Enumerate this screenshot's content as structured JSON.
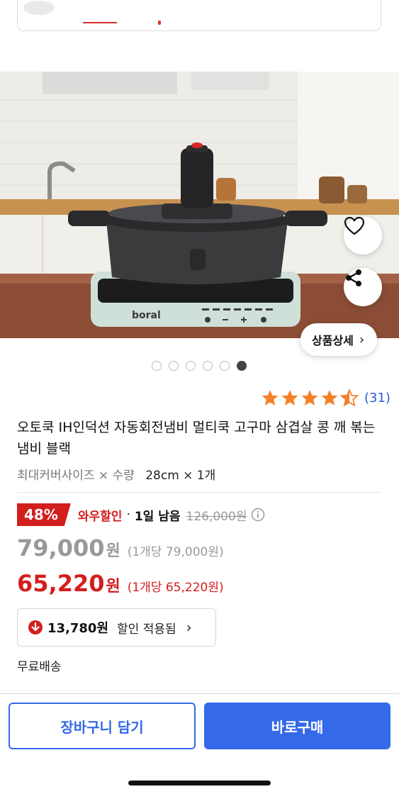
{
  "product": {
    "title": "오토쿡 IH인덕션 자동회전냄비 멀티쿡 고구마 삼겹살 콩 깨 볶는 냄비 블랙",
    "option_label": "최대커버사이즈 × 수량",
    "option_value": "28cm × 1개",
    "rating_value": 4.5,
    "rating_count": "(31)",
    "image_count": 6,
    "active_image_index": 5,
    "brand_mark": "boral"
  },
  "hero": {
    "detail_label": "상품상세",
    "detail_chevron": "›"
  },
  "pricing": {
    "discount_pct": "48%",
    "wow_label": "와우할인",
    "separator": "·",
    "remaining": "1일 남음",
    "original_price": "126,000원",
    "price_num": "79,000",
    "price_won": "원",
    "price_unit": "(1개당 79,000원)",
    "wow_price_num": "65,220",
    "wow_price_won": "원",
    "wow_price_unit": "(1개당 65,220원)"
  },
  "coupon": {
    "amount": "13,780원",
    "label": "할인 적용됨",
    "chevron": "›"
  },
  "shipping": {
    "label": "무료배송"
  },
  "bottom_bar": {
    "cart_label": "장바구니 담기",
    "buy_label": "바로구매"
  },
  "colors": {
    "accent_blue": "#3469e8",
    "sale_red": "#d31e1e",
    "star_orange": "#f5802a",
    "link_blue": "#2a5bd7"
  },
  "icons": {
    "back": "back-arrow-icon",
    "search": "search-icon",
    "cart": "cart-icon",
    "heart": "heart-icon",
    "share": "share-icon",
    "info": "info-icon",
    "coupon_down": "arrow-down-circle-icon"
  }
}
